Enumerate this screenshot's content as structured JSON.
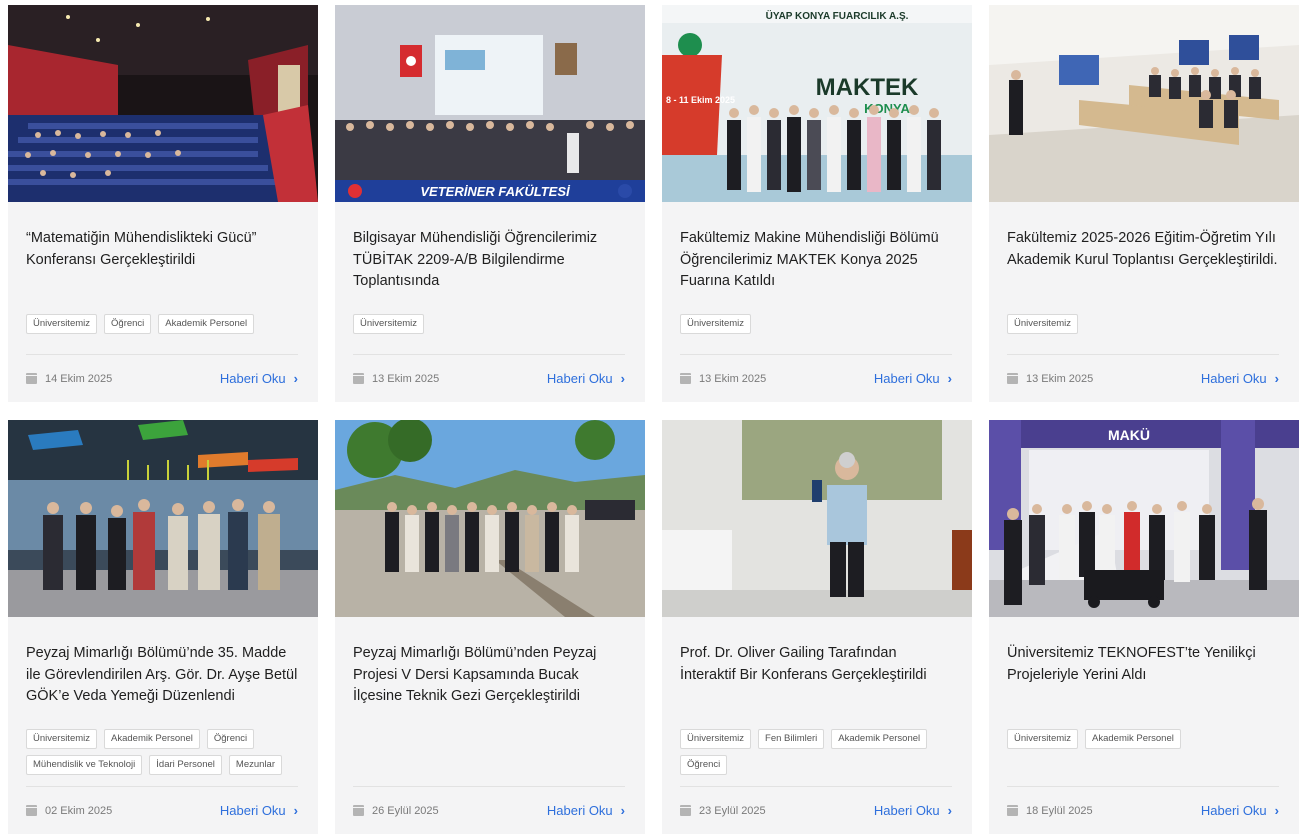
{
  "cards": [
    {
      "title": "“Matematiğin Mühendislikteki Gücü” Konferansı Gerçekleştirildi",
      "tags": [
        "Üniversitemiz",
        "Öğrenci",
        "Akademik Personel"
      ],
      "date": "14 Ekim 2025",
      "read_label": "Haberi Oku",
      "image": "conference-hall-photo"
    },
    {
      "title": "Bilgisayar Mühendisliği Öğrencilerimiz TÜBİTAK 2209-A/B Bilgilendirme Toplantısında",
      "tags": [
        "Üniversitemiz"
      ],
      "date": "13 Ekim 2025",
      "read_label": "Haberi Oku",
      "image": "group-photo-auditorium",
      "banner_text": "VETERİNER FAKÜLTESİ"
    },
    {
      "title": "Fakültemiz Makine Mühendisliği Bölümü Öğrencilerimiz MAKTEK Konya 2025 Fuarına Katıldı",
      "tags": [
        "Üniversitemiz"
      ],
      "date": "13 Ekim 2025",
      "read_label": "Haberi Oku",
      "image": "fair-group-photo",
      "banner_text": "MAKTEK",
      "banner_sub": "KONYA",
      "banner_top": "ÜYAP KONYA FUARCILIK A.Ş.",
      "banner_dates": "8 - 11 Ekim 2025"
    },
    {
      "title": "Fakültemiz 2025-2026 Eğitim-Öğretim Yılı Akademik Kurul Toplantısı Gerçekleştirildi.",
      "tags": [
        "Üniversitemiz"
      ],
      "date": "13 Ekim 2025",
      "read_label": "Haberi Oku",
      "image": "meeting-hall-photo"
    },
    {
      "title": "Peyzaj Mimarlığı Bölümü’nde 35. Madde ile Görevlendirilen Arş. Gör. Dr. Ayşe Betül GÖK’e Veda Yemeği Düzenlendi",
      "tags": [
        "Üniversitemiz",
        "Akademik Personel",
        "Öğrenci",
        "Mühendislik ve Teknoloji",
        "İdari Personel",
        "Mezunlar"
      ],
      "date": "02 Ekim 2025",
      "read_label": "Haberi Oku",
      "image": "restaurant-group-photo"
    },
    {
      "title": "Peyzaj Mimarlığı Bölümü’nden Peyzaj Projesi V Dersi Kapsamında Bucak İlçesine Teknik Gezi Gerçekleştirildi",
      "tags": [],
      "date": "26 Eylül 2025",
      "read_label": "Haberi Oku",
      "image": "outdoor-group-photo"
    },
    {
      "title": "Prof. Dr. Oliver Gailing Tarafından İnteraktif Bir Konferans Gerçekleştirildi",
      "tags": [
        "Üniversitemiz",
        "Fen Bilimleri",
        "Akademik Personel",
        "Öğrenci"
      ],
      "date": "23 Eylül 2025",
      "read_label": "Haberi Oku",
      "image": "speaker-portrait-photo"
    },
    {
      "title": "Üniversitemiz TEKNOFEST’te Yenilikçi Projeleriyle Yerini Aldı",
      "tags": [
        "Üniversitemiz",
        "Akademik Personel"
      ],
      "date": "18 Eylül 2025",
      "read_label": "Haberi Oku",
      "image": "teknofest-stand-photo",
      "banner_text": "MAKÜ"
    }
  ],
  "colors": {
    "card_bg": "#f4f4f5",
    "link": "#2e6fdc",
    "tag_border": "#d9d9d9"
  }
}
